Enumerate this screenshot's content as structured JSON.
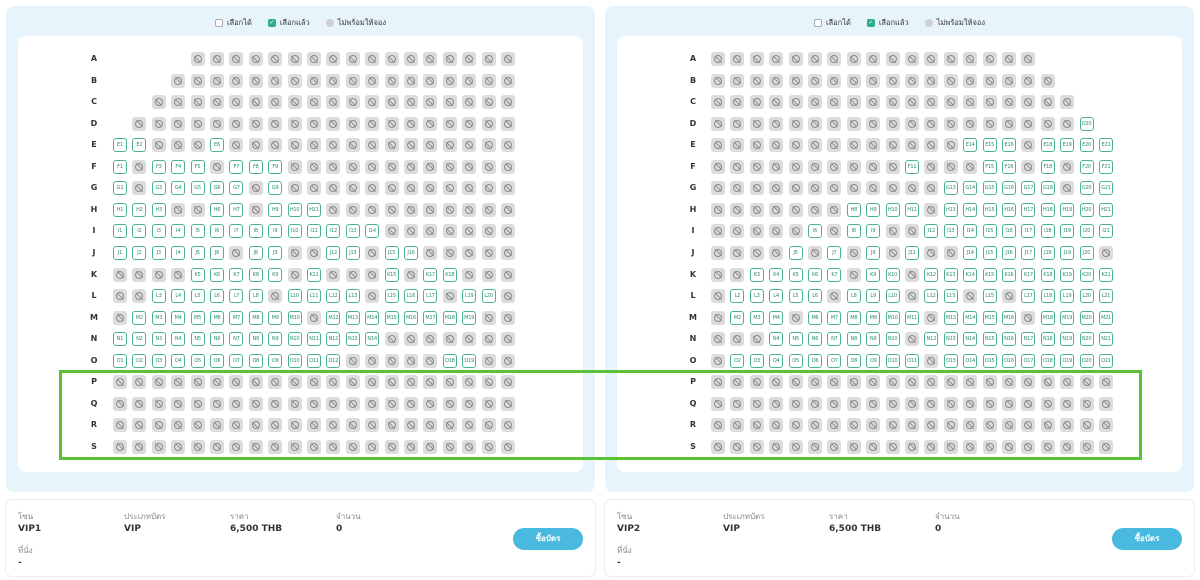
{
  "legend": {
    "available": "เลือกได้",
    "selected": "เลือกแล้ว",
    "unavailable": "ไม่พร้อมให้จอง"
  },
  "labels": {
    "zone": "โซน",
    "ticket_type": "ประเภทบัตร",
    "price": "ราคา",
    "quantity": "จำนวน",
    "seats": "ที่นั่ง"
  },
  "buy_button_label": "ซื้อบัตร",
  "zones": [
    {
      "zone": "VIP1",
      "ticket_type": "VIP",
      "price": "6,500 THB",
      "quantity": "0",
      "seats": "-",
      "rows": [
        {
          "label": "A",
          "start": 4,
          "seats": "UUUUUUUUUUUUUUUUU"
        },
        {
          "label": "B",
          "start": 3,
          "seats": "UUUUUUUUUUUUUUUUUU"
        },
        {
          "label": "C",
          "start": 2,
          "seats": "UUUUUUUUUUUUUUUUUUU"
        },
        {
          "label": "D",
          "start": 1,
          "seats": "UUUUUUUUUUUUUUUUUUUU"
        },
        {
          "label": "E",
          "start": 0,
          "seats": "AAUUUAUUUUUUUUUUUUUUU"
        },
        {
          "label": "F",
          "start": 0,
          "seats": "AUAAAUAAAUUUUUUUUUUUU"
        },
        {
          "label": "G",
          "start": 0,
          "seats": "AUAAAAAUAUUUUUUUUUUUU"
        },
        {
          "label": "H",
          "start": 0,
          "seats": "AAAUUAAUAAAUUUUUUUUUU"
        },
        {
          "label": "I",
          "start": 0,
          "seats": "AAAAAAAAAAAAAAUUUUUUU"
        },
        {
          "label": "J",
          "start": 0,
          "seats": "AAAAAAUAAUUAAUAAUUUUU"
        },
        {
          "label": "K",
          "start": 0,
          "seats": "UUUUAAAAAUAUUUAUAAUUU"
        },
        {
          "label": "L",
          "start": 0,
          "seats": "UUAAAAAAUAAAAUAAAUAAU"
        },
        {
          "label": "M",
          "start": 0,
          "seats": "UAAAAAAAAAUAAAAAAAAUU"
        },
        {
          "label": "N",
          "start": 0,
          "seats": "AAAAAAAAAAAAAAUUUUUUU"
        },
        {
          "label": "O",
          "start": 0,
          "seats": "AAAAAAAAAAAAUUUUUAAUU"
        },
        {
          "label": "P",
          "start": 0,
          "seats": "UUUUUUUUUUUUUUUUUUUUU"
        },
        {
          "label": "Q",
          "start": 0,
          "seats": "UUUUUUUUUUUUUUUUUUUUU"
        },
        {
          "label": "R",
          "start": 0,
          "seats": "UUUUUUUUUUUUUUUUUUUUU"
        },
        {
          "label": "S",
          "start": 0,
          "seats": "UUUUUUUUUUUUUUUUUUUUU"
        }
      ]
    },
    {
      "zone": "VIP2",
      "ticket_type": "VIP",
      "price": "6,500 THB",
      "quantity": "0",
      "seats": "-",
      "rows": [
        {
          "label": "A",
          "start": 0,
          "seats": "UUUUUUUUUUUUUUUUU"
        },
        {
          "label": "B",
          "start": 0,
          "seats": "UUUUUUUUUUUUUUUUUU"
        },
        {
          "label": "C",
          "start": 0,
          "seats": "UUUUUUUUUUUUUUUUUUU"
        },
        {
          "label": "D",
          "start": 0,
          "seats": "UUUUUUUUUUUUUUUUUUUA"
        },
        {
          "label": "E",
          "start": 0,
          "seats": "UUUUUUUUUUUUUAAAUAAAA"
        },
        {
          "label": "F",
          "start": 0,
          "seats": "UUUUUUUUUUAUUUAAUAUAA"
        },
        {
          "label": "G",
          "start": 0,
          "seats": "UUUUUUUUUUUUAAAAAAUAA"
        },
        {
          "label": "H",
          "start": 0,
          "seats": "UUUUUUUAAAAUAAAAAAAAA"
        },
        {
          "label": "I",
          "start": 0,
          "seats": "UUUUUAUAAUUAAAAAAAAAA"
        },
        {
          "label": "J",
          "start": 0,
          "seats": "UUUUAUAUAUAUUAAAAAAAU"
        },
        {
          "label": "K",
          "start": 0,
          "seats": "UUAAAAAUAAUAAAAAAAAAA"
        },
        {
          "label": "L",
          "start": 0,
          "seats": "UAAAAAUAAAUAAUAUAAAAA"
        },
        {
          "label": "M",
          "start": 0,
          "seats": "UAAAUAAAAAAUAAAAUAAAA"
        },
        {
          "label": "N",
          "start": 0,
          "seats": "UUUAAAAAAAUAAAAAAAAAA"
        },
        {
          "label": "O",
          "start": 0,
          "seats": "UAAAAAAAAAAUAAAAAAAAA"
        },
        {
          "label": "P",
          "start": 0,
          "seats": "UUUUUUUUUUUUUUUUUUUUU"
        },
        {
          "label": "Q",
          "start": 0,
          "seats": "UUUUUUUUUUUUUUUUUUUUU"
        },
        {
          "label": "R",
          "start": 0,
          "seats": "UUUUUUUUUUUUUUUUUUUUU"
        },
        {
          "label": "S",
          "start": 0,
          "seats": "UUUUUUUUUUUUUUUUUUUUU"
        }
      ]
    }
  ],
  "colors": {
    "available_border": "#4cb38f",
    "unavailable_fill": "#dcdcdc",
    "highlight": "#5bc236",
    "buy_button": "#4ab9e0",
    "panel_bg": "#e8f4fb"
  }
}
